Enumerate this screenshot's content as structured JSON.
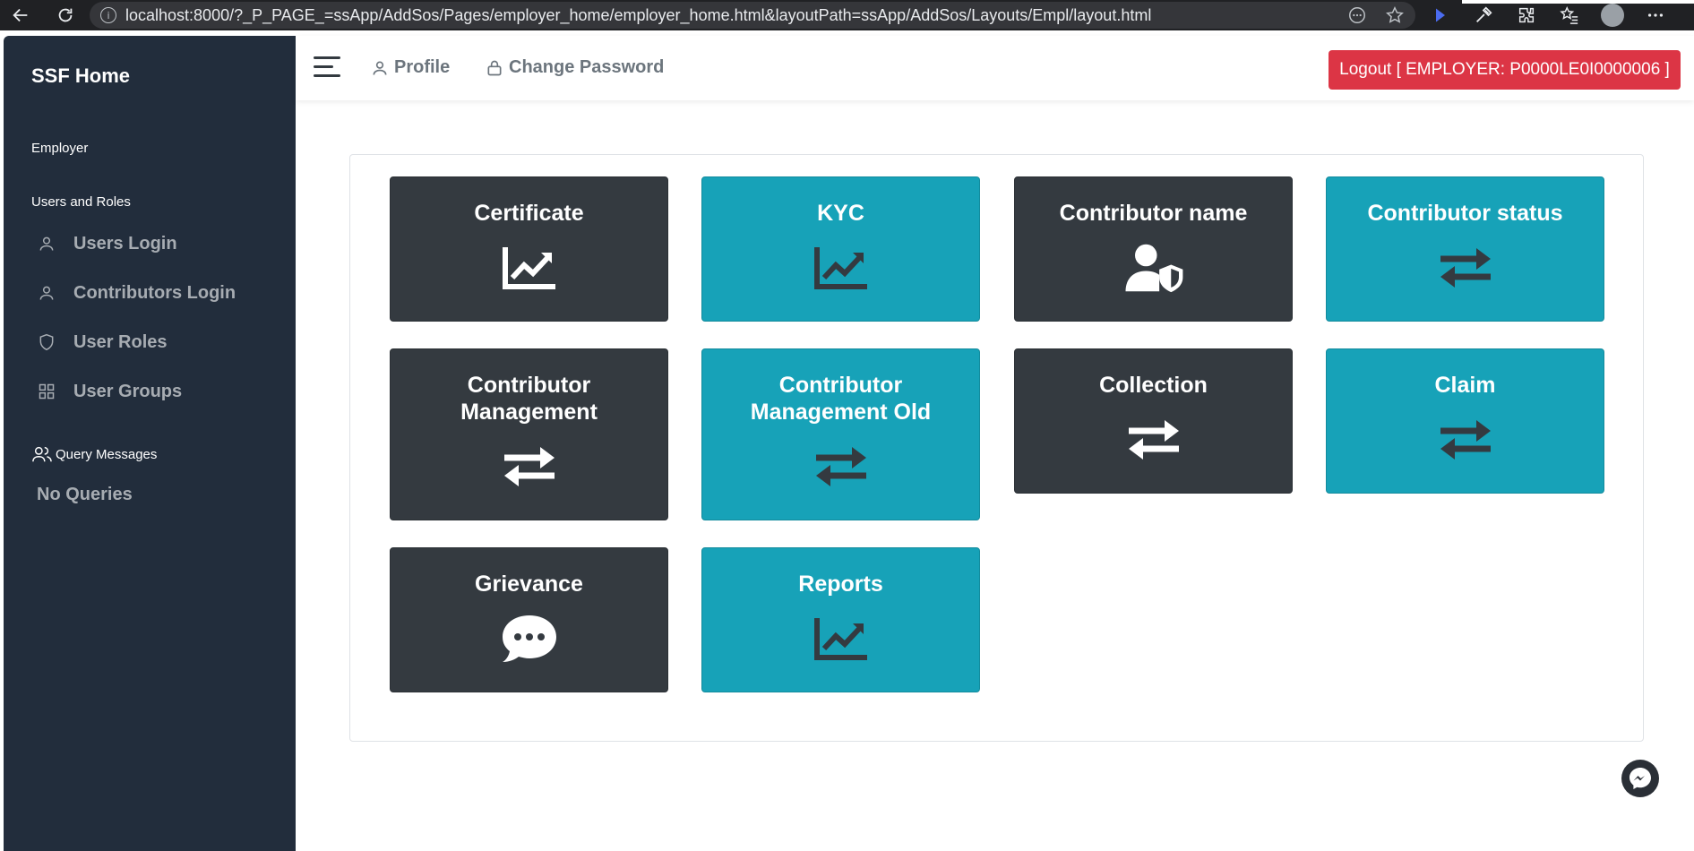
{
  "browser": {
    "url": "localhost:8000/?_P_PAGE_=ssApp/AddSos/Pages/employer_home/employer_home.html&layoutPath=ssApp/AddSos/Layouts/Empl/layout.html"
  },
  "sidebar": {
    "brand": "SSF Home",
    "section_employer": "Employer",
    "section_users": "Users and Roles",
    "items": [
      {
        "label": "Users Login",
        "icon": "user-icon"
      },
      {
        "label": "Contributors Login",
        "icon": "user-icon"
      },
      {
        "label": "User Roles",
        "icon": "shield-icon"
      },
      {
        "label": "User Groups",
        "icon": "grid-icon"
      }
    ],
    "query_label": "Query Messages",
    "no_queries": "No Queries"
  },
  "header": {
    "profile": "Profile",
    "change_password": "Change Password",
    "logout": "Logout [ EMPLOYER: P0000LE0I0000006 ]"
  },
  "tiles": [
    {
      "title": "Certificate",
      "icon": "chart-line-icon",
      "theme": "dark"
    },
    {
      "title": "KYC",
      "icon": "chart-line-icon",
      "theme": "teal"
    },
    {
      "title": "Contributor name",
      "icon": "user-shield-icon",
      "theme": "dark"
    },
    {
      "title": "Contributor status",
      "icon": "exchange-icon",
      "theme": "teal"
    },
    {
      "title": "Contributor Management",
      "icon": "exchange-icon",
      "theme": "dark"
    },
    {
      "title": "Contributor Management Old",
      "icon": "exchange-icon",
      "theme": "teal"
    },
    {
      "title": "Collection",
      "icon": "exchange-icon",
      "theme": "dark"
    },
    {
      "title": "Claim",
      "icon": "exchange-icon",
      "theme": "teal"
    },
    {
      "title": "Grievance",
      "icon": "comment-dots-icon",
      "theme": "dark"
    },
    {
      "title": "Reports",
      "icon": "chart-line-icon",
      "theme": "teal"
    }
  ],
  "colors": {
    "sidebar": "#222d3c",
    "tile_dark": "#343a40",
    "tile_teal": "#17a2b8",
    "logout": "#dc3545"
  }
}
